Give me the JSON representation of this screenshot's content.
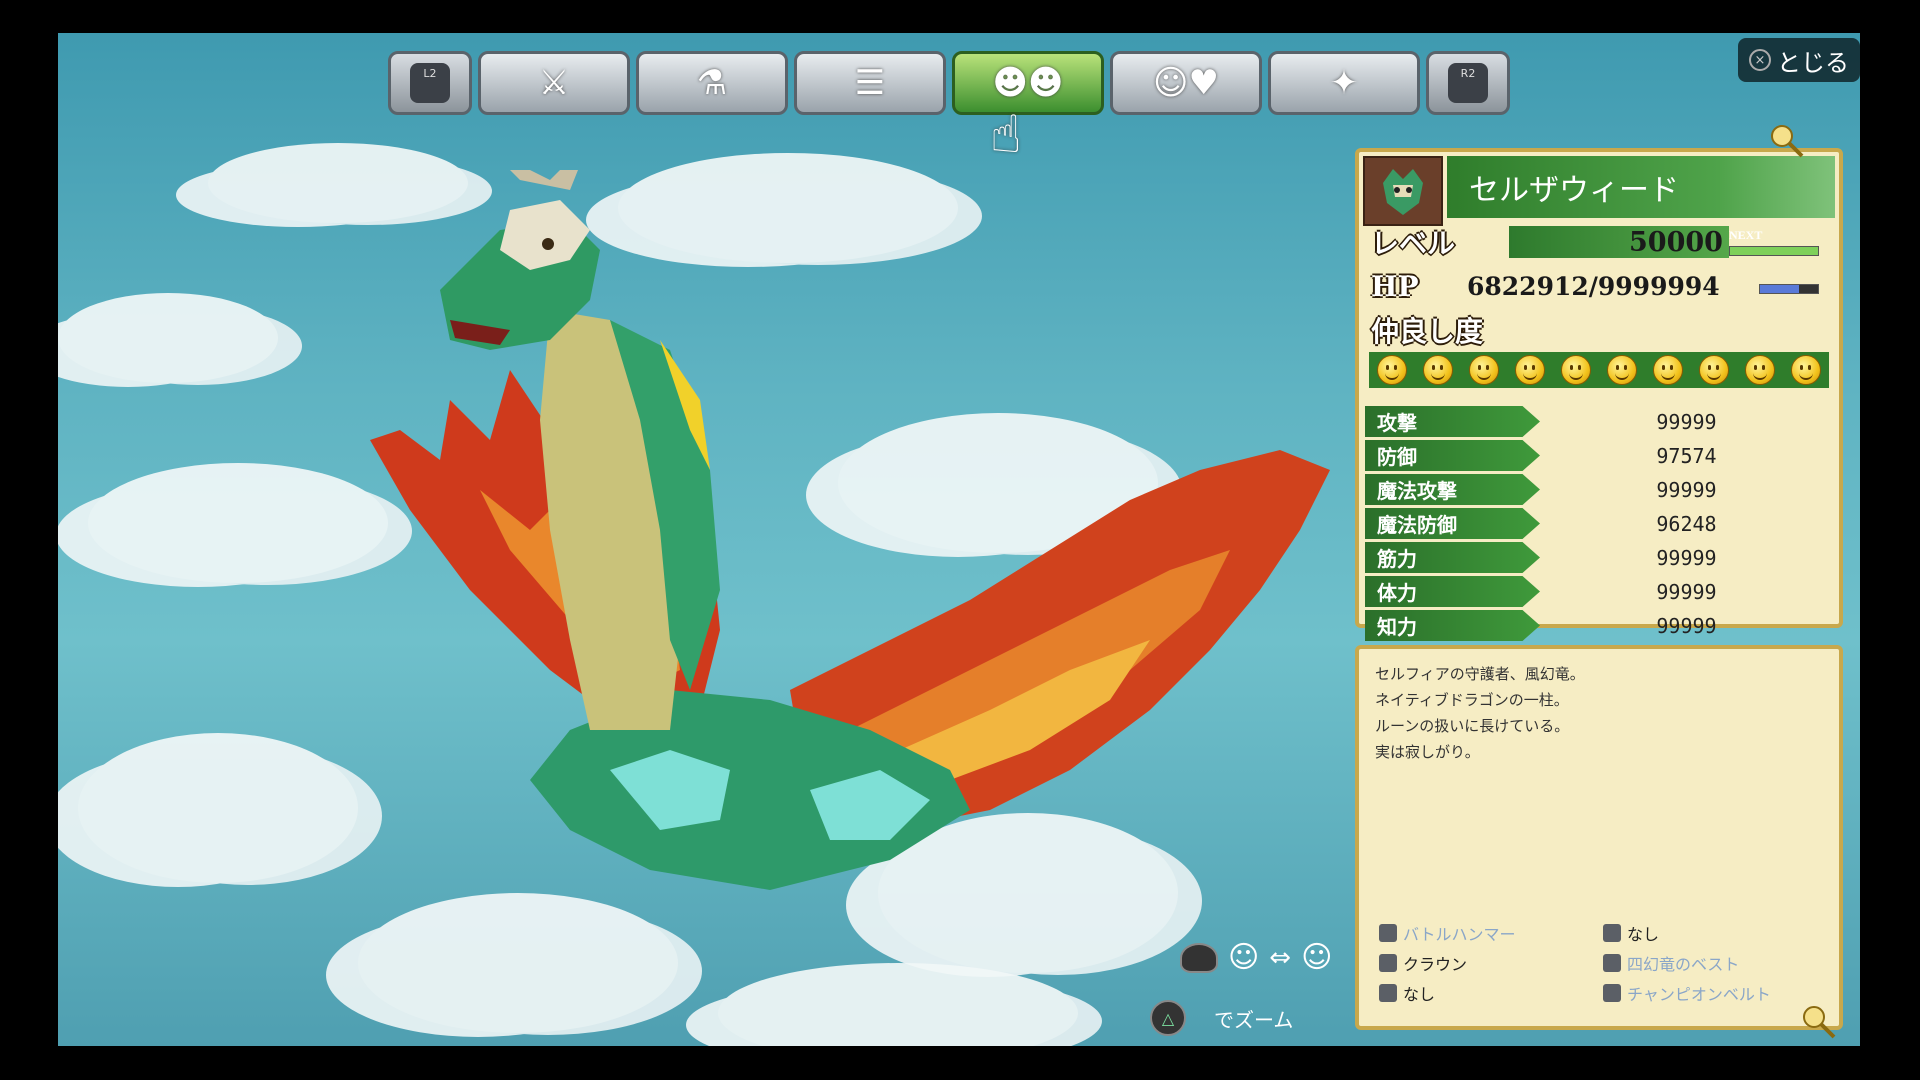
{
  "close": {
    "label": "とじる",
    "button_glyph": "×"
  },
  "tabs": [
    {
      "name": "L2",
      "icon": "l2-button-icon"
    },
    {
      "icon": "sword-shield-icon"
    },
    {
      "icon": "flask-hammer-icon"
    },
    {
      "icon": "document-icon"
    },
    {
      "icon": "monster-companions-icon",
      "active": true
    },
    {
      "icon": "smile-heart-icon"
    },
    {
      "icon": "wrench-icon"
    },
    {
      "name": "R2",
      "icon": "r2-button-icon"
    }
  ],
  "monster": {
    "name": "セルザウィード",
    "level_label": "レベル",
    "level": "50000",
    "next_label": "NEXT",
    "next_progress": 1.0,
    "hp_label": "HP",
    "hp": "6822912/9999994",
    "hp_progress": 0.68,
    "friendship_label": "仲良し度",
    "friendship_count": 10
  },
  "stats": [
    {
      "label": "攻撃",
      "value": "99999"
    },
    {
      "label": "防御",
      "value": "97574"
    },
    {
      "label": "魔法攻撃",
      "value": "99999"
    },
    {
      "label": "魔法防御",
      "value": "96248"
    },
    {
      "label": "筋力",
      "value": "99999"
    },
    {
      "label": "体力",
      "value": "99999"
    },
    {
      "label": "知力",
      "value": "99999"
    }
  ],
  "description": [
    "セルフィアの守護者、風幻竜。",
    "ネイティブドラゴンの一柱。",
    "ルーンの扱いに長けている。",
    "実は寂しがり。"
  ],
  "equipment": [
    {
      "label": "バトルハンマー",
      "color": "#8aa6c8"
    },
    {
      "label": "なし",
      "color": "#222222"
    },
    {
      "label": "クラウン",
      "color": "#222222"
    },
    {
      "label": "四幻竜のベスト",
      "color": "#8aa6c8"
    },
    {
      "label": "なし",
      "color": "#222222"
    },
    {
      "label": "チャンピオンベルト",
      "color": "#8aa6c8"
    }
  ],
  "hints": {
    "zoom_label": "でズーム",
    "triangle_glyph": "△"
  },
  "colors": {
    "accent_green": "#3f9a3b",
    "panel_bg": "#f6edc4",
    "panel_border": "#c8a84c"
  }
}
